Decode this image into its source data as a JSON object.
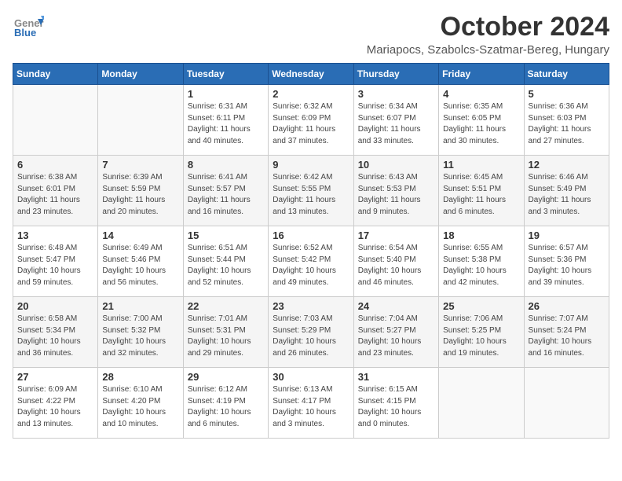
{
  "logo": {
    "general": "General",
    "blue": "Blue"
  },
  "title": "October 2024",
  "subtitle": "Mariapocs, Szabolcs-Szatmar-Bereg, Hungary",
  "headers": [
    "Sunday",
    "Monday",
    "Tuesday",
    "Wednesday",
    "Thursday",
    "Friday",
    "Saturday"
  ],
  "weeks": [
    [
      {
        "day": "",
        "info": ""
      },
      {
        "day": "",
        "info": ""
      },
      {
        "day": "1",
        "info": "Sunrise: 6:31 AM\nSunset: 6:11 PM\nDaylight: 11 hours and 40 minutes."
      },
      {
        "day": "2",
        "info": "Sunrise: 6:32 AM\nSunset: 6:09 PM\nDaylight: 11 hours and 37 minutes."
      },
      {
        "day": "3",
        "info": "Sunrise: 6:34 AM\nSunset: 6:07 PM\nDaylight: 11 hours and 33 minutes."
      },
      {
        "day": "4",
        "info": "Sunrise: 6:35 AM\nSunset: 6:05 PM\nDaylight: 11 hours and 30 minutes."
      },
      {
        "day": "5",
        "info": "Sunrise: 6:36 AM\nSunset: 6:03 PM\nDaylight: 11 hours and 27 minutes."
      }
    ],
    [
      {
        "day": "6",
        "info": "Sunrise: 6:38 AM\nSunset: 6:01 PM\nDaylight: 11 hours and 23 minutes."
      },
      {
        "day": "7",
        "info": "Sunrise: 6:39 AM\nSunset: 5:59 PM\nDaylight: 11 hours and 20 minutes."
      },
      {
        "day": "8",
        "info": "Sunrise: 6:41 AM\nSunset: 5:57 PM\nDaylight: 11 hours and 16 minutes."
      },
      {
        "day": "9",
        "info": "Sunrise: 6:42 AM\nSunset: 5:55 PM\nDaylight: 11 hours and 13 minutes."
      },
      {
        "day": "10",
        "info": "Sunrise: 6:43 AM\nSunset: 5:53 PM\nDaylight: 11 hours and 9 minutes."
      },
      {
        "day": "11",
        "info": "Sunrise: 6:45 AM\nSunset: 5:51 PM\nDaylight: 11 hours and 6 minutes."
      },
      {
        "day": "12",
        "info": "Sunrise: 6:46 AM\nSunset: 5:49 PM\nDaylight: 11 hours and 3 minutes."
      }
    ],
    [
      {
        "day": "13",
        "info": "Sunrise: 6:48 AM\nSunset: 5:47 PM\nDaylight: 10 hours and 59 minutes."
      },
      {
        "day": "14",
        "info": "Sunrise: 6:49 AM\nSunset: 5:46 PM\nDaylight: 10 hours and 56 minutes."
      },
      {
        "day": "15",
        "info": "Sunrise: 6:51 AM\nSunset: 5:44 PM\nDaylight: 10 hours and 52 minutes."
      },
      {
        "day": "16",
        "info": "Sunrise: 6:52 AM\nSunset: 5:42 PM\nDaylight: 10 hours and 49 minutes."
      },
      {
        "day": "17",
        "info": "Sunrise: 6:54 AM\nSunset: 5:40 PM\nDaylight: 10 hours and 46 minutes."
      },
      {
        "day": "18",
        "info": "Sunrise: 6:55 AM\nSunset: 5:38 PM\nDaylight: 10 hours and 42 minutes."
      },
      {
        "day": "19",
        "info": "Sunrise: 6:57 AM\nSunset: 5:36 PM\nDaylight: 10 hours and 39 minutes."
      }
    ],
    [
      {
        "day": "20",
        "info": "Sunrise: 6:58 AM\nSunset: 5:34 PM\nDaylight: 10 hours and 36 minutes."
      },
      {
        "day": "21",
        "info": "Sunrise: 7:00 AM\nSunset: 5:32 PM\nDaylight: 10 hours and 32 minutes."
      },
      {
        "day": "22",
        "info": "Sunrise: 7:01 AM\nSunset: 5:31 PM\nDaylight: 10 hours and 29 minutes."
      },
      {
        "day": "23",
        "info": "Sunrise: 7:03 AM\nSunset: 5:29 PM\nDaylight: 10 hours and 26 minutes."
      },
      {
        "day": "24",
        "info": "Sunrise: 7:04 AM\nSunset: 5:27 PM\nDaylight: 10 hours and 23 minutes."
      },
      {
        "day": "25",
        "info": "Sunrise: 7:06 AM\nSunset: 5:25 PM\nDaylight: 10 hours and 19 minutes."
      },
      {
        "day": "26",
        "info": "Sunrise: 7:07 AM\nSunset: 5:24 PM\nDaylight: 10 hours and 16 minutes."
      }
    ],
    [
      {
        "day": "27",
        "info": "Sunrise: 6:09 AM\nSunset: 4:22 PM\nDaylight: 10 hours and 13 minutes."
      },
      {
        "day": "28",
        "info": "Sunrise: 6:10 AM\nSunset: 4:20 PM\nDaylight: 10 hours and 10 minutes."
      },
      {
        "day": "29",
        "info": "Sunrise: 6:12 AM\nSunset: 4:19 PM\nDaylight: 10 hours and 6 minutes."
      },
      {
        "day": "30",
        "info": "Sunrise: 6:13 AM\nSunset: 4:17 PM\nDaylight: 10 hours and 3 minutes."
      },
      {
        "day": "31",
        "info": "Sunrise: 6:15 AM\nSunset: 4:15 PM\nDaylight: 10 hours and 0 minutes."
      },
      {
        "day": "",
        "info": ""
      },
      {
        "day": "",
        "info": ""
      }
    ]
  ]
}
